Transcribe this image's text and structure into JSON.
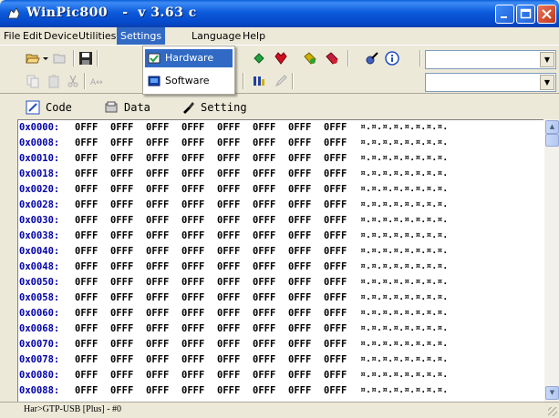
{
  "window": {
    "title": "WinPic800   -  v 3.63 c"
  },
  "menu": [
    {
      "label": "File",
      "active": false
    },
    {
      "label": "Edit",
      "active": false
    },
    {
      "label": "Device",
      "active": false
    },
    {
      "label": "Utilities",
      "active": false
    },
    {
      "label": "Settings",
      "active": true
    },
    {
      "label": "Language",
      "active": false
    },
    {
      "label": "Help",
      "active": false
    }
  ],
  "settings_menu": {
    "items": [
      {
        "label": "Hardware",
        "selected": true,
        "icon": "hardware-icon"
      },
      {
        "label": "Software",
        "selected": false,
        "icon": "software-icon"
      }
    ]
  },
  "combo1": {
    "value": ""
  },
  "combo2": {
    "value": ""
  },
  "tabs": [
    {
      "label": "Code",
      "icon": "code-icon"
    },
    {
      "label": "Data",
      "icon": "data-icon"
    },
    {
      "label": "Setting",
      "icon": "setting-icon"
    }
  ],
  "hex": {
    "rows": [
      {
        "addr": "0x0000:",
        "words": [
          "0FFF",
          "0FFF",
          "0FFF",
          "0FFF",
          "0FFF",
          "0FFF",
          "0FFF",
          "0FFF"
        ],
        "ascii": "¤.¤.¤.¤.¤.¤.¤.¤."
      },
      {
        "addr": "0x0008:",
        "words": [
          "0FFF",
          "0FFF",
          "0FFF",
          "0FFF",
          "0FFF",
          "0FFF",
          "0FFF",
          "0FFF"
        ],
        "ascii": "¤.¤.¤.¤.¤.¤.¤.¤."
      },
      {
        "addr": "0x0010:",
        "words": [
          "0FFF",
          "0FFF",
          "0FFF",
          "0FFF",
          "0FFF",
          "0FFF",
          "0FFF",
          "0FFF"
        ],
        "ascii": "¤.¤.¤.¤.¤.¤.¤.¤."
      },
      {
        "addr": "0x0018:",
        "words": [
          "0FFF",
          "0FFF",
          "0FFF",
          "0FFF",
          "0FFF",
          "0FFF",
          "0FFF",
          "0FFF"
        ],
        "ascii": "¤.¤.¤.¤.¤.¤.¤.¤."
      },
      {
        "addr": "0x0020:",
        "words": [
          "0FFF",
          "0FFF",
          "0FFF",
          "0FFF",
          "0FFF",
          "0FFF",
          "0FFF",
          "0FFF"
        ],
        "ascii": "¤.¤.¤.¤.¤.¤.¤.¤."
      },
      {
        "addr": "0x0028:",
        "words": [
          "0FFF",
          "0FFF",
          "0FFF",
          "0FFF",
          "0FFF",
          "0FFF",
          "0FFF",
          "0FFF"
        ],
        "ascii": "¤.¤.¤.¤.¤.¤.¤.¤."
      },
      {
        "addr": "0x0030:",
        "words": [
          "0FFF",
          "0FFF",
          "0FFF",
          "0FFF",
          "0FFF",
          "0FFF",
          "0FFF",
          "0FFF"
        ],
        "ascii": "¤.¤.¤.¤.¤.¤.¤.¤."
      },
      {
        "addr": "0x0038:",
        "words": [
          "0FFF",
          "0FFF",
          "0FFF",
          "0FFF",
          "0FFF",
          "0FFF",
          "0FFF",
          "0FFF"
        ],
        "ascii": "¤.¤.¤.¤.¤.¤.¤.¤."
      },
      {
        "addr": "0x0040:",
        "words": [
          "0FFF",
          "0FFF",
          "0FFF",
          "0FFF",
          "0FFF",
          "0FFF",
          "0FFF",
          "0FFF"
        ],
        "ascii": "¤.¤.¤.¤.¤.¤.¤.¤."
      },
      {
        "addr": "0x0048:",
        "words": [
          "0FFF",
          "0FFF",
          "0FFF",
          "0FFF",
          "0FFF",
          "0FFF",
          "0FFF",
          "0FFF"
        ],
        "ascii": "¤.¤.¤.¤.¤.¤.¤.¤."
      },
      {
        "addr": "0x0050:",
        "words": [
          "0FFF",
          "0FFF",
          "0FFF",
          "0FFF",
          "0FFF",
          "0FFF",
          "0FFF",
          "0FFF"
        ],
        "ascii": "¤.¤.¤.¤.¤.¤.¤.¤."
      },
      {
        "addr": "0x0058:",
        "words": [
          "0FFF",
          "0FFF",
          "0FFF",
          "0FFF",
          "0FFF",
          "0FFF",
          "0FFF",
          "0FFF"
        ],
        "ascii": "¤.¤.¤.¤.¤.¤.¤.¤."
      },
      {
        "addr": "0x0060:",
        "words": [
          "0FFF",
          "0FFF",
          "0FFF",
          "0FFF",
          "0FFF",
          "0FFF",
          "0FFF",
          "0FFF"
        ],
        "ascii": "¤.¤.¤.¤.¤.¤.¤.¤."
      },
      {
        "addr": "0x0068:",
        "words": [
          "0FFF",
          "0FFF",
          "0FFF",
          "0FFF",
          "0FFF",
          "0FFF",
          "0FFF",
          "0FFF"
        ],
        "ascii": "¤.¤.¤.¤.¤.¤.¤.¤."
      },
      {
        "addr": "0x0070:",
        "words": [
          "0FFF",
          "0FFF",
          "0FFF",
          "0FFF",
          "0FFF",
          "0FFF",
          "0FFF",
          "0FFF"
        ],
        "ascii": "¤.¤.¤.¤.¤.¤.¤.¤."
      },
      {
        "addr": "0x0078:",
        "words": [
          "0FFF",
          "0FFF",
          "0FFF",
          "0FFF",
          "0FFF",
          "0FFF",
          "0FFF",
          "0FFF"
        ],
        "ascii": "¤.¤.¤.¤.¤.¤.¤.¤."
      },
      {
        "addr": "0x0080:",
        "words": [
          "0FFF",
          "0FFF",
          "0FFF",
          "0FFF",
          "0FFF",
          "0FFF",
          "0FFF",
          "0FFF"
        ],
        "ascii": "¤.¤.¤.¤.¤.¤.¤.¤."
      },
      {
        "addr": "0x0088:",
        "words": [
          "0FFF",
          "0FFF",
          "0FFF",
          "0FFF",
          "0FFF",
          "0FFF",
          "0FFF",
          "0FFF"
        ],
        "ascii": "¤.¤.¤.¤.¤.¤.¤.¤."
      }
    ]
  },
  "status": {
    "text": "Har>GTP-USB [Plus] - #0"
  },
  "colors": {
    "title_bar": "#0A5FD8",
    "menu_highlight": "#316AC5",
    "address_text": "#0000AA"
  }
}
